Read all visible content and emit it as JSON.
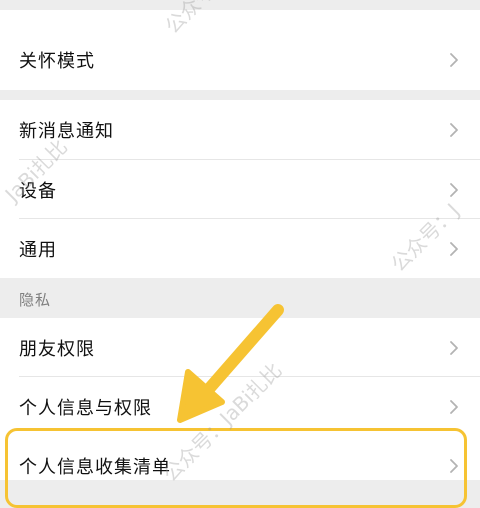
{
  "menu": {
    "care_mode": "关怀模式",
    "new_message_notification": "新消息通知",
    "device": "设备",
    "general": "通用"
  },
  "privacy": {
    "section_title": "隐私",
    "friend_permissions": "朋友权限",
    "personal_info_permissions": "个人信息与权限",
    "personal_info_collection_list": "个人信息收集清单"
  },
  "watermarks": [
    "公众号：",
    "JaBi扎比",
    "公众号：J",
    "公众号：JaBi扎比"
  ],
  "colors": {
    "accent_highlight": "#f6c333",
    "background": "#ededed",
    "cell": "#ffffff",
    "section_title": "#7f7f7f",
    "chevron": "#b3b3b3"
  },
  "icons": {
    "row_chevron": "chevron-right-icon",
    "pointer": "arrow-down-left-icon"
  }
}
